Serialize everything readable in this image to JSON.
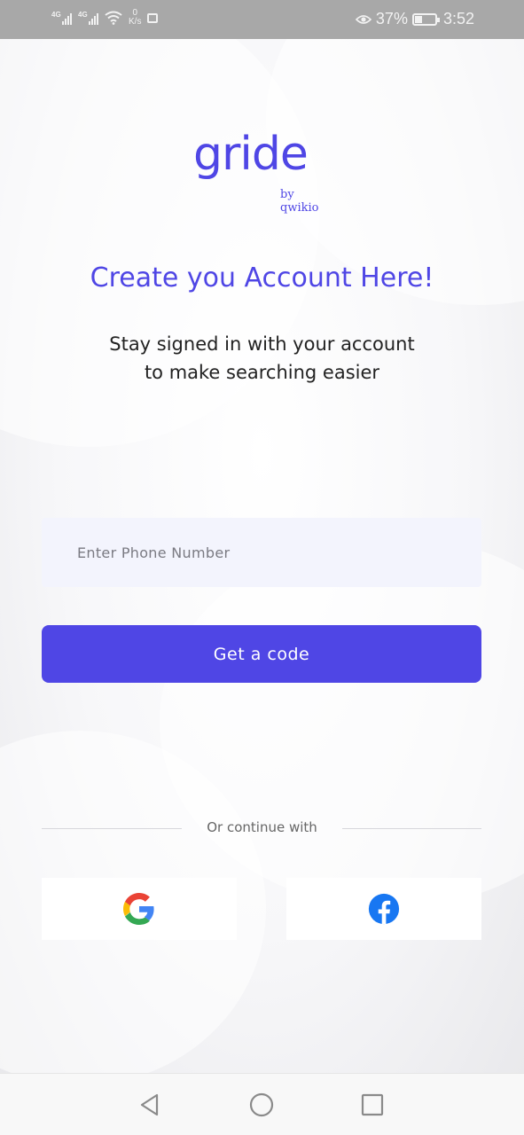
{
  "status_bar": {
    "network_1": "4G",
    "network_2": "4G",
    "data_speed_value": "0",
    "data_speed_unit": "K/s",
    "battery": "37%",
    "battery_level": 0.37,
    "time": "3:52"
  },
  "logo": {
    "brand": "gride",
    "byline": "by qwikio"
  },
  "header": {
    "title": "Create you Account Here!",
    "subtitle_line1": "Stay signed in with your account",
    "subtitle_line2": "to make searching easier"
  },
  "form": {
    "phone_placeholder": "Enter Phone Number",
    "phone_value": "",
    "submit_label": "Get a code"
  },
  "social": {
    "divider_label": "Or continue with",
    "providers": [
      {
        "name": "Google",
        "icon": "google-icon"
      },
      {
        "name": "Facebook",
        "icon": "facebook-icon"
      }
    ]
  },
  "colors": {
    "accent": "#4f46e5",
    "input_bg": "#f3f4fd",
    "facebook": "#1877f2"
  },
  "nav": {
    "icons": [
      "back-icon",
      "home-icon",
      "recents-icon"
    ]
  }
}
